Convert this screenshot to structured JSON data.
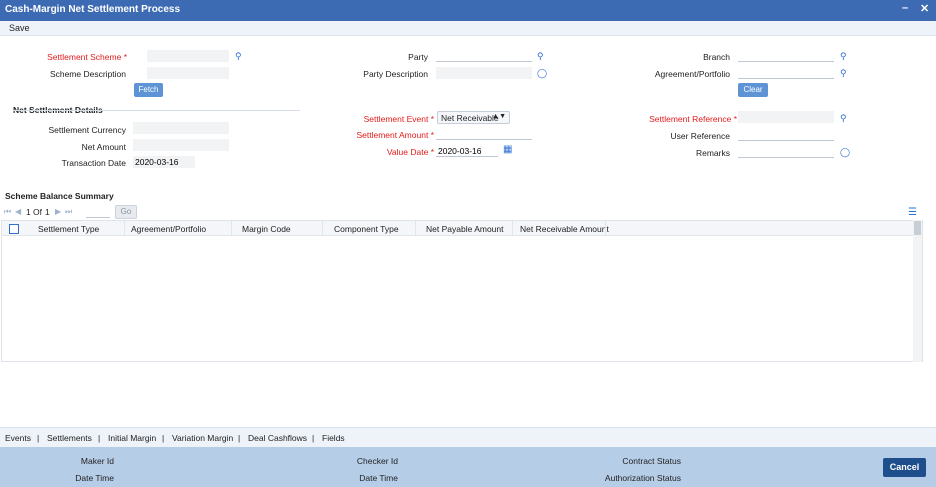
{
  "window": {
    "title": "Cash-Margin Net Settlement Process",
    "minimize_glyph": "–",
    "close_glyph": "✕"
  },
  "toolbar": {
    "save_label": "Save"
  },
  "form": {
    "settlement_scheme_label": "Settlement Scheme",
    "scheme_description_label": "Scheme Description",
    "fetch_label": "Fetch",
    "party_label": "Party",
    "party_description_label": "Party Description",
    "branch_label": "Branch",
    "agreement_portfolio_label": "Agreement/Portfolio",
    "clear_label": "Clear",
    "required_mark": "*"
  },
  "net_settlement": {
    "section_title": "Net Settlement Details",
    "settlement_currency_label": "Settlement Currency",
    "net_amount_label": "Net Amount",
    "transaction_date_label": "Transaction Date",
    "transaction_date_value": "2020-03-16",
    "settlement_event_label": "Settlement Event",
    "settlement_event_value": "Net Receivable",
    "settlement_amount_label": "Settlement Amount",
    "value_date_label": "Value Date",
    "value_date_value": "2020-03-16",
    "settlement_reference_label": "Settlement Reference",
    "user_reference_label": "User Reference",
    "remarks_label": "Remarks"
  },
  "summary": {
    "section_title": "Scheme Balance Summary",
    "page_current": "1",
    "page_of": "Of",
    "page_total": "1",
    "go_label": "Go",
    "columns": [
      "Settlement Type",
      "Agreement/Portfolio",
      "Margin Code",
      "Component Type",
      "Net Payable Amount",
      "Net Receivable Amount"
    ]
  },
  "tabs": [
    "Events",
    "Settlements",
    "Initial Margin",
    "Variation Margin",
    "Deal Cashflows",
    "Fields"
  ],
  "tab_separator": "|",
  "footer": {
    "maker_id_label": "Maker Id",
    "date_time_label": "Date Time",
    "checker_id_label": "Checker Id",
    "checker_date_time_label": "Date Time",
    "contract_status_label": "Contract Status",
    "authorization_status_label": "Authorization Status",
    "cancel_label": "Cancel"
  },
  "colors": {
    "title_bar": "#3d6bb3",
    "required_text": "#e31c1c",
    "accent_icon": "#2f6fd0",
    "footer_bg": "#b6cde8",
    "cancel_bg": "#1f4e8c"
  },
  "icons": {
    "search": "search-icon",
    "comment": "comment-icon",
    "calendar": "calendar-icon",
    "columns": "columns-icon"
  }
}
